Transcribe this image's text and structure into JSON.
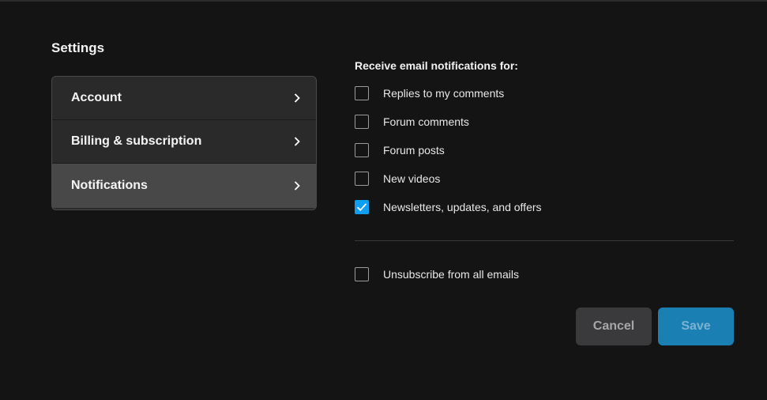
{
  "page": {
    "title": "Settings"
  },
  "nav": {
    "items": [
      {
        "label": "Account",
        "icon": "chevron-right-icon",
        "active": false
      },
      {
        "label": "Billing & subscription",
        "icon": "chevron-right-icon",
        "active": false
      },
      {
        "label": "Notifications",
        "icon": "chevron-right-icon",
        "active": true
      }
    ]
  },
  "notifications": {
    "heading": "Receive email notifications for:",
    "options": [
      {
        "label": "Replies to my comments",
        "checked": false
      },
      {
        "label": "Forum comments",
        "checked": false
      },
      {
        "label": "Forum posts",
        "checked": false
      },
      {
        "label": "New videos",
        "checked": false
      },
      {
        "label": "Newsletters, updates, and offers",
        "checked": true
      }
    ],
    "unsubscribe": {
      "label": "Unsubscribe from all emails",
      "checked": false
    }
  },
  "actions": {
    "cancel_label": "Cancel",
    "save_label": "Save"
  },
  "colors": {
    "background": "#141415",
    "accent": "#0f9ff0",
    "save_button": "#1a7fb3",
    "cancel_button": "#3a3a3c"
  }
}
